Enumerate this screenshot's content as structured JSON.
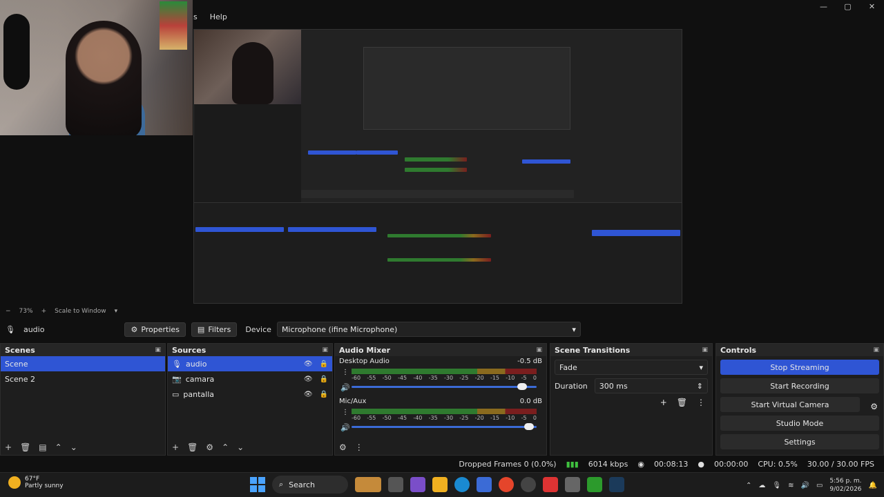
{
  "window": {
    "menu": [
      "s",
      "Help"
    ],
    "controls": [
      "—",
      "▢",
      "✕"
    ]
  },
  "preview": {
    "zoom_label": "73%",
    "scale_label": "Scale to Window"
  },
  "source_toolbar": {
    "source_name": "audio",
    "properties_label": "Properties",
    "filters_label": "Filters",
    "device_label": "Device",
    "device_value": "Microphone (ifine Microphone)"
  },
  "scenes": {
    "title": "Scenes",
    "items": [
      "Scene",
      "Scene 2"
    ]
  },
  "sources": {
    "title": "Sources",
    "items": [
      {
        "name": "audio",
        "icon": "microphone-icon"
      },
      {
        "name": "camara",
        "icon": "camera-icon"
      },
      {
        "name": "pantalla",
        "icon": "monitor-icon"
      }
    ]
  },
  "mixer": {
    "title": "Audio Mixer",
    "channels": [
      {
        "name": "Desktop Audio",
        "db": "-0.5 dB",
        "level": 0.92
      },
      {
        "name": "Mic/Aux",
        "db": "0.0 dB",
        "level": 0.96
      }
    ],
    "scale": [
      "-60",
      "-55",
      "-50",
      "-45",
      "-40",
      "-35",
      "-30",
      "-25",
      "-20",
      "-15",
      "-10",
      "-5",
      "0"
    ]
  },
  "transitions": {
    "title": "Scene Transitions",
    "type": "Fade",
    "duration_label": "Duration",
    "duration_value": "300 ms"
  },
  "controls": {
    "title": "Controls",
    "stop_streaming": "Stop Streaming",
    "start_recording": "Start Recording",
    "start_virtual_camera": "Start Virtual Camera",
    "studio_mode": "Studio Mode",
    "settings": "Settings"
  },
  "status": {
    "dropped": "Dropped Frames 0 (0.0%)",
    "bitrate": "6014 kbps",
    "stream_time": "00:08:13",
    "rec_time": "00:00:00",
    "cpu": "CPU: 0.5%",
    "fps": "30.00 / 30.00 FPS"
  },
  "taskbar": {
    "temp": "67°F",
    "weather": "Partly sunny",
    "search": "Search",
    "time": "5:56 p. m.",
    "date": "9/02/2026"
  },
  "colors": {
    "accent": "#2f55d4",
    "meter_green": "#2f7a2f",
    "meter_yellow": "#8a6a1e",
    "meter_red": "#7a1e1e"
  }
}
